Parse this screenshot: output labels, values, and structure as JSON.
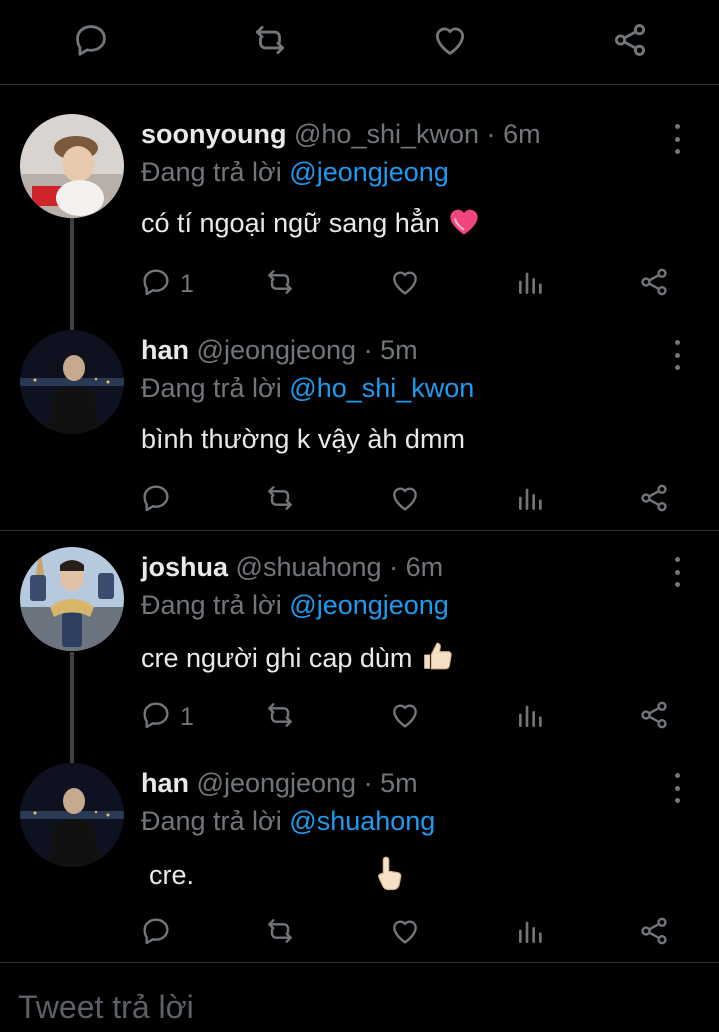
{
  "top_actions": {
    "icons": [
      "reply-icon",
      "retweet-icon",
      "like-icon",
      "share-icon"
    ]
  },
  "tweets": [
    {
      "name": "soonyoung",
      "handle": "@ho_shi_kwon",
      "dot": "·",
      "time": "6m",
      "reply_prefix": "Đang trả lời",
      "reply_to": "@jeongjeong",
      "text": "có tí ngoại ngữ sang hẳn",
      "emoji": "pink-heart-emoji",
      "reply_count": "1"
    },
    {
      "name": "han",
      "handle": "@jeongjeong",
      "dot": "·",
      "time": "5m",
      "reply_prefix": "Đang trả lời",
      "reply_to": "@ho_shi_kwon",
      "text": "bình thường k vậy àh dmm",
      "reply_count": ""
    },
    {
      "name": "joshua",
      "handle": "@shuahong",
      "dot": "·",
      "time": "6m",
      "reply_prefix": "Đang trả lời",
      "reply_to": "@jeongjeong",
      "text": "cre người ghi cap dùm",
      "emoji": "thumbs-up-emoji",
      "reply_count": "1"
    },
    {
      "name": "han",
      "handle": "@jeongjeong",
      "dot": "·",
      "time": "5m",
      "reply_prefix": "Đang trả lời",
      "reply_to": "@shuahong",
      "text": "cre.",
      "emoji": "pointing-up-emoji",
      "reply_count": ""
    }
  ],
  "reply_box": {
    "placeholder": "Tweet trả lời"
  },
  "colors": {
    "background": "#000000",
    "text": "#e7e9ea",
    "muted": "#71767b",
    "link": "#1d9bf0",
    "separator": "#2f3336"
  }
}
